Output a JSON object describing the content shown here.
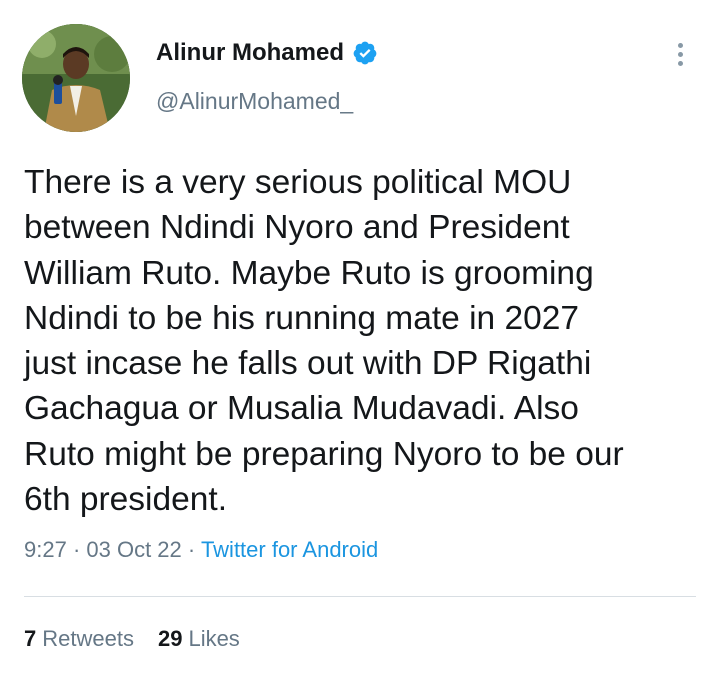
{
  "author": {
    "display_name": "Alinur Mohamed",
    "handle": "@AlinurMohamed_",
    "verified": true,
    "avatar_icon": "profile-photo-avatar"
  },
  "tweet": {
    "text_lines": [
      "There is a very serious political MOU",
      "between Ndindi Nyoro and President",
      "William Ruto. Maybe Ruto is grooming",
      "Ndindi to be his running mate in 2027",
      "just incase he falls out with DP Rigathi",
      "Gachagua or Musalia Mudavadi. Also",
      "Ruto might be preparing Nyoro to be our",
      "6th president."
    ]
  },
  "meta": {
    "time": "9:27",
    "separator": " · ",
    "date": "03 Oct 22",
    "source": "Twitter for Android"
  },
  "stats": {
    "retweets_count": "7",
    "retweets_label": "Retweets",
    "likes_count": "29",
    "likes_label": "Likes"
  },
  "colors": {
    "text": "#14171a",
    "secondary": "#657786",
    "link": "#1b95e0",
    "verified": "#1da1f2",
    "divider": "#d8dee3"
  },
  "icons": {
    "verified": "verified-badge-icon",
    "more": "more-vertical-icon"
  }
}
